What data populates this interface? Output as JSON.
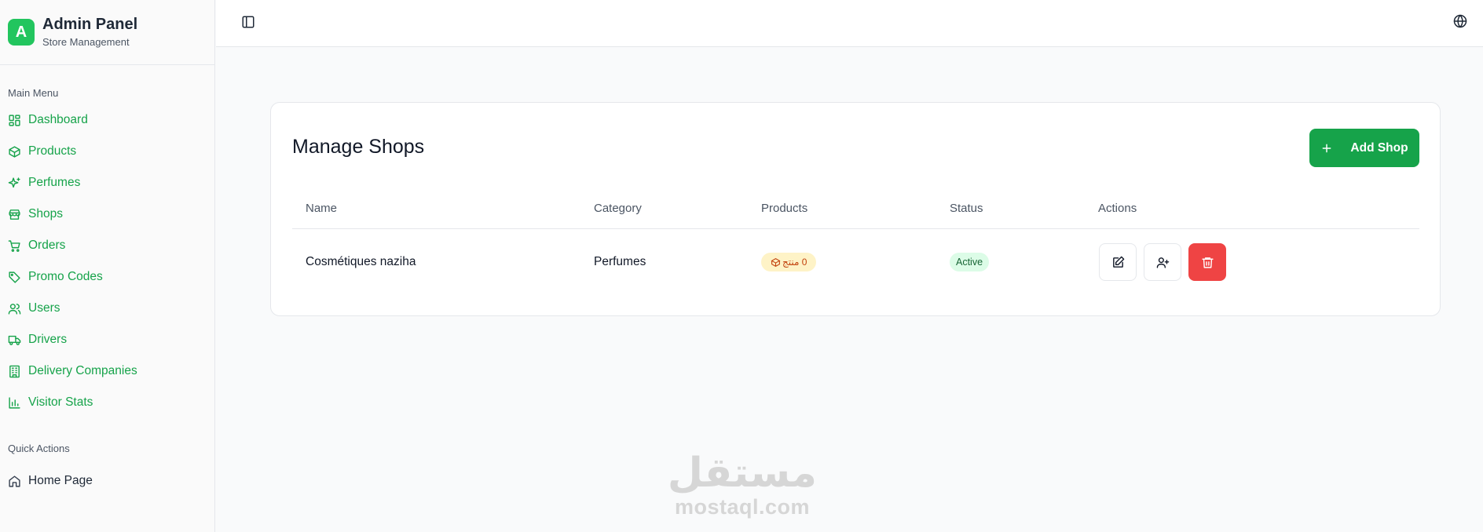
{
  "brand": {
    "logo_letter": "A",
    "title": "Admin Panel",
    "subtitle": "Store Management"
  },
  "sidebar": {
    "main_label": "Main Menu",
    "items": [
      {
        "label": "Dashboard",
        "icon": "layout-dashboard-icon"
      },
      {
        "label": "Products",
        "icon": "package-icon"
      },
      {
        "label": "Perfumes",
        "icon": "sparkles-icon"
      },
      {
        "label": "Shops",
        "icon": "store-icon"
      },
      {
        "label": "Orders",
        "icon": "shopping-cart-icon"
      },
      {
        "label": "Promo Codes",
        "icon": "tag-icon"
      },
      {
        "label": "Users",
        "icon": "users-icon"
      },
      {
        "label": "Drivers",
        "icon": "truck-icon"
      },
      {
        "label": "Delivery Companies",
        "icon": "building-icon"
      },
      {
        "label": "Visitor Stats",
        "icon": "bar-chart-icon"
      }
    ],
    "quick_label": "Quick Actions",
    "quick_items": [
      {
        "label": "Home Page",
        "icon": "home-icon"
      }
    ]
  },
  "header": {
    "toggle_icon": "panel-left-icon",
    "language_icon": "globe-icon"
  },
  "main": {
    "title": "Manage Shops",
    "add_button": "Add Shop",
    "columns": [
      "Name",
      "Category",
      "Products",
      "Status",
      "Actions"
    ],
    "rows": [
      {
        "name": "Cosmétiques naziha",
        "category": "Perfumes",
        "products": "0 منتج",
        "status": "Active"
      }
    ]
  },
  "watermark": {
    "arabic": "مستقل",
    "latin": "mostaql.com"
  },
  "colors": {
    "accent": "#16a34a",
    "brand_logo": "#22c55e",
    "danger": "#ef4444",
    "badge_products_bg": "#fef3c7",
    "badge_status_bg": "#dcfce7"
  }
}
